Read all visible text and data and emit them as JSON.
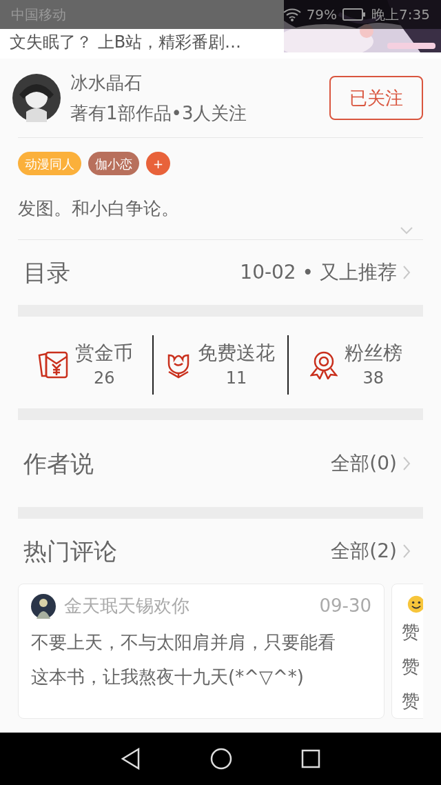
{
  "status_bar": {
    "carrier": "中国移动",
    "battery": "79%",
    "time": "晚上7:35"
  },
  "ad_banner": {
    "text": "文失眠了？ 上B站，精彩番剧…",
    "kind": "picture"
  },
  "author": {
    "name": "冰水晶石",
    "stats": "著有1部作品•3人关注",
    "follow_button": "已关注",
    "followed": true
  },
  "tags": [
    {
      "label": "动漫同人",
      "color": "#fbb03b"
    },
    {
      "label": "伽小恋",
      "color": "#b8705c"
    },
    {
      "label": "+",
      "color": "#e8623a"
    }
  ],
  "bio": "发图。和小白争论。",
  "catalog": {
    "title": "目录",
    "latest": "10-02 • 又上推荐"
  },
  "actions": [
    {
      "kind": "coin",
      "label": "赏金币",
      "count": "26"
    },
    {
      "kind": "flower",
      "label": "免费送花",
      "count": "11"
    },
    {
      "kind": "medal",
      "label": "粉丝榜",
      "count": "38"
    }
  ],
  "author_notes": {
    "title": "作者说",
    "link": "全部(0)"
  },
  "hot_comments": {
    "title": "热门评论",
    "link": "全部(2)",
    "comments": [
      {
        "user": "金天珉天锡欢你",
        "date": "09-30",
        "text": "不要上天，不与太阳肩并肩，只要能看这本书，让我熬夜十九天(*^▽^*)"
      },
      {
        "lines": [
          "赞",
          "赞",
          "赞"
        ]
      }
    ]
  }
}
